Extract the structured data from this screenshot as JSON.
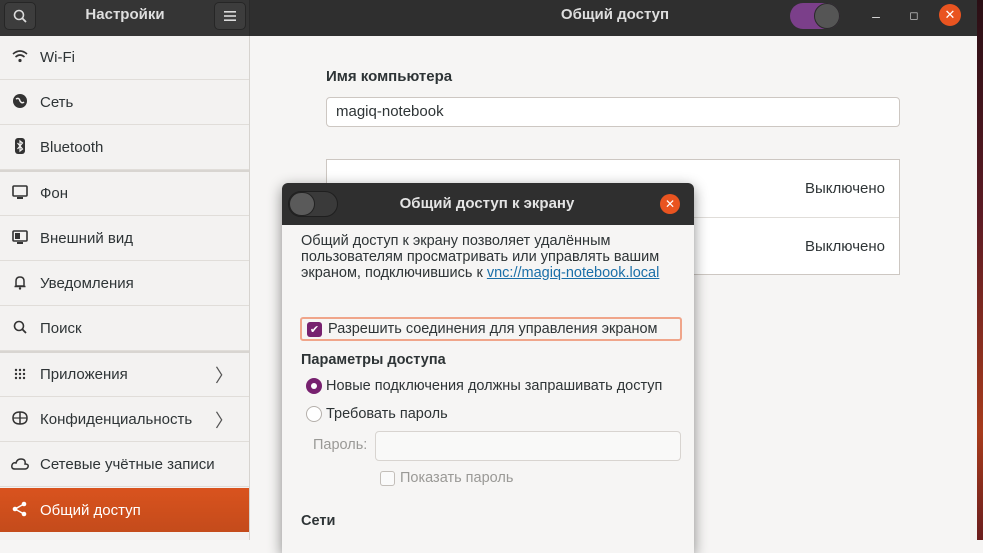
{
  "header": {
    "left_title": "Настройки",
    "right_title": "Общий доступ",
    "window_controls": {
      "minimize": "–",
      "maximize": "◻",
      "close": "✕"
    }
  },
  "sidebar": {
    "items": [
      {
        "label": "Wi-Fi",
        "icon": "wifi-icon"
      },
      {
        "label": "Сеть",
        "icon": "network-icon"
      },
      {
        "label": "Bluetooth",
        "icon": "bluetooth-icon"
      },
      {
        "label": "Фон",
        "icon": "background-icon"
      },
      {
        "label": "Внешний вид",
        "icon": "appearance-icon"
      },
      {
        "label": "Уведомления",
        "icon": "bell-icon"
      },
      {
        "label": "Поиск",
        "icon": "search-icon"
      },
      {
        "label": "Приложения",
        "icon": "apps-grid-icon"
      },
      {
        "label": "Конфиденциальность",
        "icon": "privacy-icon"
      },
      {
        "label": "Сетевые учётные записи",
        "icon": "online-accounts-icon"
      },
      {
        "label": "Общий доступ",
        "icon": "sharing-icon"
      }
    ]
  },
  "main": {
    "computer_name_label": "Имя компьютера",
    "computer_name_value": "magiq-notebook",
    "rows": [
      {
        "value": "Выключено"
      },
      {
        "value": "Выключено"
      }
    ]
  },
  "dialog": {
    "title": "Общий доступ к экрану",
    "description": "Общий доступ к экрану позволяет удалённым пользователям просматривать или управлять вашим экраном, подключившись к ",
    "link": "vnc://magiq-notebook.local",
    "allow_control_label": "Разрешить соединения для управления экраном",
    "access_options_title": "Параметры доступа",
    "radio_new_connections": "Новые подключения должны запрашивать доступ",
    "radio_require_password": "Требовать пароль",
    "password_label": "Пароль:",
    "show_password_label": "Показать пароль",
    "networks_title": "Сети"
  },
  "colors": {
    "accent": "#e95420",
    "purple": "#77216f"
  }
}
